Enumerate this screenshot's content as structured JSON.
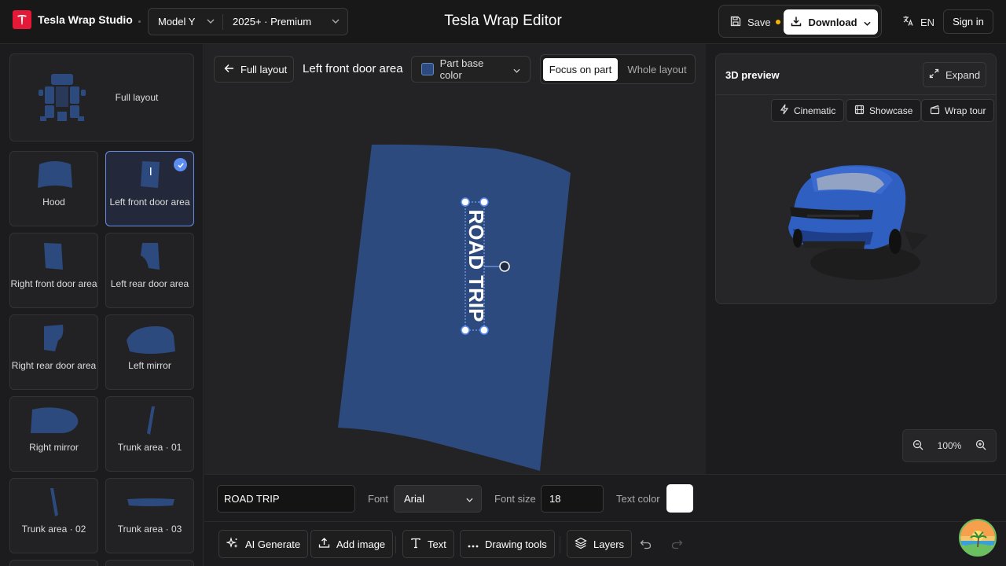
{
  "brand": {
    "name": "Tesla Wrap Studio",
    "logo_color": "#e31937"
  },
  "selectors": {
    "model": "Model Y",
    "trim": "2025+ · Premium"
  },
  "app_title": "Tesla Wrap Editor",
  "actions": {
    "save": "Save",
    "download": "Download",
    "language": "EN",
    "sign_in": "Sign in",
    "unsaved_indicator_color": "#f5b400"
  },
  "parts": {
    "full_layout": "Full layout",
    "items": [
      {
        "label": "Hood",
        "selected": false
      },
      {
        "label": "Left front door area",
        "selected": true
      },
      {
        "label": "Right front door area",
        "selected": false
      },
      {
        "label": "Left rear door area",
        "selected": false
      },
      {
        "label": "Right rear door area",
        "selected": false
      },
      {
        "label": "Left mirror",
        "selected": false
      },
      {
        "label": "Right mirror",
        "selected": false
      },
      {
        "label": "Trunk area · 01",
        "selected": false
      },
      {
        "label": "Trunk area · 02",
        "selected": false
      },
      {
        "label": "Trunk area · 03",
        "selected": false
      }
    ],
    "part_color": "#2d4a7e",
    "selected_border": "#6a8fe0"
  },
  "canvas": {
    "back": "Full layout",
    "part_name": "Left front door area",
    "base_color_label": "Part base color",
    "view_focus": "Focus on part",
    "view_whole": "Whole layout",
    "text_element": "ROAD TRIP"
  },
  "preview": {
    "title": "3D preview",
    "expand": "Expand",
    "buttons": {
      "cinematic": "Cinematic",
      "showcase": "Showcase",
      "wrap_tour": "Wrap tour"
    },
    "car_color": "#2f5fc0"
  },
  "zoom": {
    "level": "100%"
  },
  "properties": {
    "text_value": "ROAD TRIP",
    "font_label": "Font",
    "font_value": "Arial",
    "size_label": "Font size",
    "size_value": "18",
    "color_label": "Text color",
    "text_color": "#ffffff"
  },
  "toolbar": {
    "ai": "AI Generate",
    "add_image": "Add image",
    "text": "Text",
    "drawing": "Drawing tools",
    "layers": "Layers"
  }
}
